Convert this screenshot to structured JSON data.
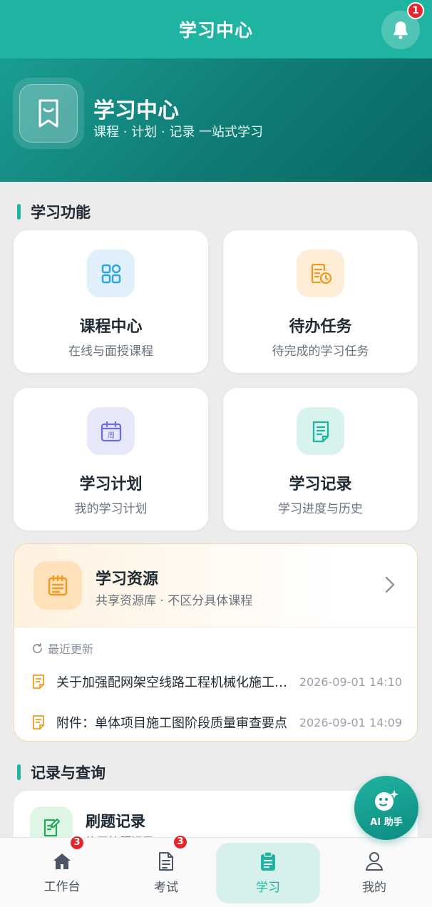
{
  "header": {
    "title": "学习中心",
    "notification_count": "1"
  },
  "hero": {
    "title": "学习中心",
    "subtitle": "课程 · 计划 · 记录 一站式学习"
  },
  "sections": {
    "functions_title": "学习功能",
    "records_title": "记录与查询"
  },
  "function_cards": [
    {
      "title": "课程中心",
      "subtitle": "在线与面授课程",
      "icon": "grid-icon",
      "color": "#2aa3e0"
    },
    {
      "title": "待办任务",
      "subtitle": "待完成的学习任务",
      "icon": "task-clock-icon",
      "color": "#f29a1f"
    },
    {
      "title": "学习计划",
      "subtitle": "我的学习计划",
      "icon": "calendar-week-icon",
      "color": "#6b6fe0",
      "icon_text": "周"
    },
    {
      "title": "学习记录",
      "subtitle": "学习进度与历史",
      "icon": "document-icon",
      "color": "#1fb4a1"
    }
  ],
  "resources": {
    "title": "学习资源",
    "subtitle": "共享资源库 · 不区分具体课程",
    "recent_label": "最近更新",
    "items": [
      {
        "title": "关于加强配网架空线路工程机械化施工管理的通知",
        "time": "2026-09-01 14:10"
      },
      {
        "title": "附件：单体项目施工图阶段质量审查要点",
        "time": "2026-09-01 14:09"
      }
    ]
  },
  "records": {
    "title": "刷题记录",
    "subtitle": "练习答题记录"
  },
  "ai_assistant": {
    "label": "AI 助手"
  },
  "tabbar": [
    {
      "label": "工作台",
      "icon": "home-icon",
      "badge": "3"
    },
    {
      "label": "考试",
      "icon": "exam-doc-icon",
      "badge": "3"
    },
    {
      "label": "学习",
      "icon": "clipboard-icon",
      "badge": ""
    },
    {
      "label": "我的",
      "icon": "user-icon",
      "badge": ""
    }
  ],
  "colors": {
    "primary": "#1fb4a1",
    "hero_dark": "#0a6763",
    "badge": "#e5242b",
    "resource_accent": "#f29a1f"
  }
}
